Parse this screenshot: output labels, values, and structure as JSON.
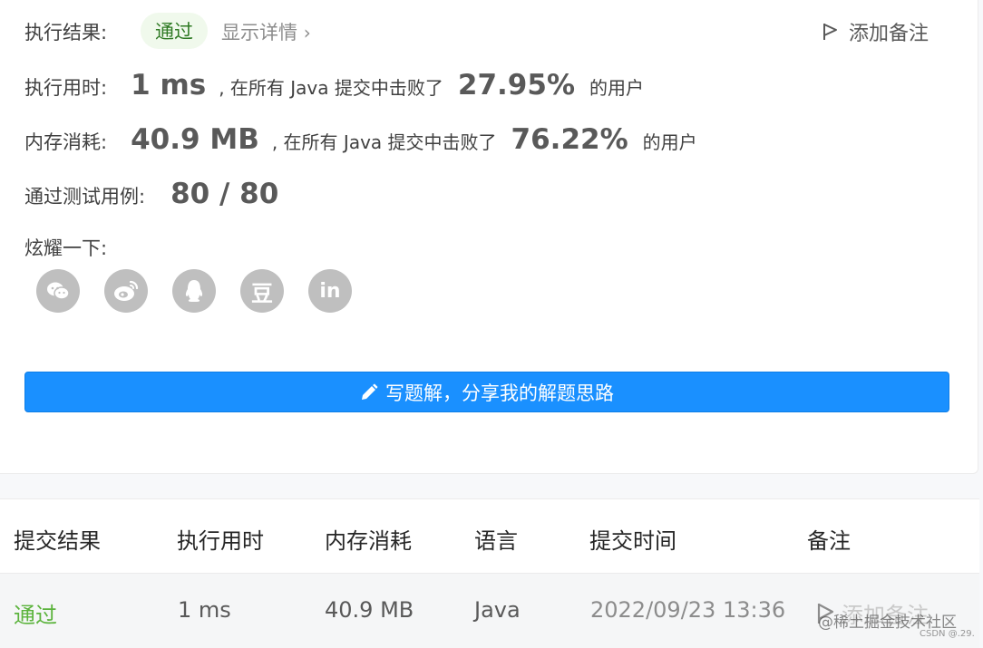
{
  "result": {
    "label": "执行结果:",
    "status": "通过",
    "detail_link": "显示详情",
    "add_note": "添加备注"
  },
  "runtime": {
    "label": "执行用时:",
    "value": "1 ms",
    "mid_text": ", 在所有 Java 提交中击败了",
    "percent": "27.95%",
    "suffix": "的用户"
  },
  "memory": {
    "label": "内存消耗:",
    "value": "40.9 MB",
    "mid_text": ", 在所有 Java 提交中击败了",
    "percent": "76.22%",
    "suffix": "的用户"
  },
  "testcases": {
    "label": "通过测试用例:",
    "value": "80 / 80"
  },
  "share": {
    "label": "炫耀一下:",
    "icons": [
      "wechat-icon",
      "weibo-icon",
      "qq-icon",
      "douban-icon",
      "linkedin-icon"
    ],
    "douban_glyph": "豆",
    "linkedin_glyph": "in"
  },
  "write_button": {
    "label": "写题解，分享我的解题思路"
  },
  "table": {
    "headers": [
      "提交结果",
      "执行用时",
      "内存消耗",
      "语言",
      "提交时间",
      "备注"
    ],
    "rows": [
      {
        "result": "通过",
        "runtime": "1 ms",
        "memory": "40.9 MB",
        "language": "Java",
        "time": "2022/09/23 13:36",
        "note": "添加备注"
      }
    ]
  },
  "watermark": {
    "main": "@稀土掘金技术社区",
    "sub": "CSDN @.29."
  },
  "colors": {
    "primary": "#1a90ff",
    "pass": "#5bb33c",
    "badge_bg": "#f0f9ec"
  }
}
